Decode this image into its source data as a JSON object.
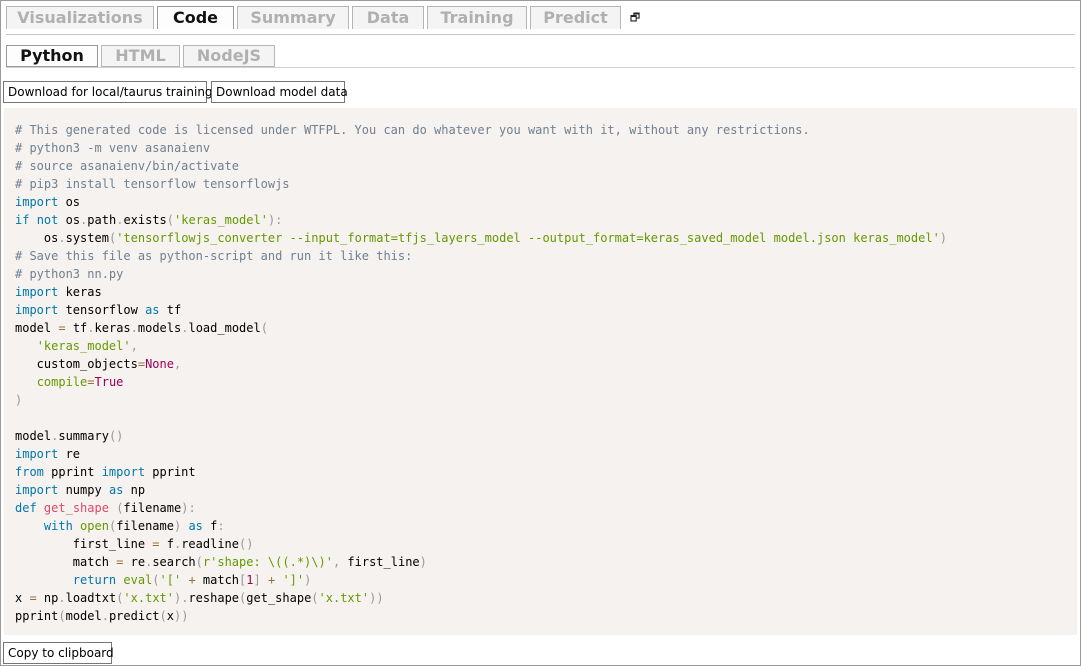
{
  "main_tabs": [
    {
      "label": "Visualizations",
      "active": false
    },
    {
      "label": "Code",
      "active": true
    },
    {
      "label": "Summary",
      "active": false
    },
    {
      "label": "Data",
      "active": false
    },
    {
      "label": "Training",
      "active": false
    },
    {
      "label": "Predict",
      "active": false
    }
  ],
  "restore_icon_glyph": "🗗",
  "sub_tabs": [
    {
      "label": "Python",
      "active": true
    },
    {
      "label": "HTML",
      "active": false
    },
    {
      "label": "NodeJS",
      "active": false
    }
  ],
  "buttons": {
    "download_local": "Download for local/taurus training",
    "download_model_data": "Download model data",
    "copy": "Copy to clipboard"
  },
  "code": {
    "language": "python",
    "lines": [
      [
        {
          "t": "c",
          "v": "# This generated code is licensed under WTFPL. You can do whatever you want with it, without any restrictions."
        }
      ],
      [
        {
          "t": "c",
          "v": "# python3 -m venv asanaienv"
        }
      ],
      [
        {
          "t": "c",
          "v": "# source asanaienv/bin/activate"
        }
      ],
      [
        {
          "t": "c",
          "v": "# pip3 install tensorflow tensorflowjs"
        }
      ],
      [
        {
          "t": "k",
          "v": "import"
        },
        {
          "t": "",
          "v": " os"
        }
      ],
      [
        {
          "t": "k",
          "v": "if"
        },
        {
          "t": "",
          "v": " "
        },
        {
          "t": "k",
          "v": "not"
        },
        {
          "t": "",
          "v": " os"
        },
        {
          "t": "p",
          "v": "."
        },
        {
          "t": "",
          "v": "path"
        },
        {
          "t": "p",
          "v": "."
        },
        {
          "t": "",
          "v": "exists"
        },
        {
          "t": "p",
          "v": "("
        },
        {
          "t": "s",
          "v": "'keras_model'"
        },
        {
          "t": "p",
          "v": "):"
        }
      ],
      [
        {
          "t": "",
          "v": "    os"
        },
        {
          "t": "p",
          "v": "."
        },
        {
          "t": "",
          "v": "system"
        },
        {
          "t": "p",
          "v": "("
        },
        {
          "t": "s",
          "v": "'tensorflowjs_converter --input_format=tfjs_layers_model --output_format=keras_saved_model model.json keras_model'"
        },
        {
          "t": "p",
          "v": ")"
        }
      ],
      [
        {
          "t": "c",
          "v": "# Save this file as python-script and run it like this:"
        }
      ],
      [
        {
          "t": "c",
          "v": "# python3 nn.py"
        }
      ],
      [
        {
          "t": "k",
          "v": "import"
        },
        {
          "t": "",
          "v": " keras"
        }
      ],
      [
        {
          "t": "k",
          "v": "import"
        },
        {
          "t": "",
          "v": " tensorflow "
        },
        {
          "t": "k",
          "v": "as"
        },
        {
          "t": "",
          "v": " tf"
        }
      ],
      [
        {
          "t": "",
          "v": "model "
        },
        {
          "t": "o",
          "v": "="
        },
        {
          "t": "",
          "v": " tf"
        },
        {
          "t": "p",
          "v": "."
        },
        {
          "t": "",
          "v": "keras"
        },
        {
          "t": "p",
          "v": "."
        },
        {
          "t": "",
          "v": "models"
        },
        {
          "t": "p",
          "v": "."
        },
        {
          "t": "",
          "v": "load_model"
        },
        {
          "t": "p",
          "v": "("
        }
      ],
      [
        {
          "t": "",
          "v": "   "
        },
        {
          "t": "s",
          "v": "'keras_model'"
        },
        {
          "t": "p",
          "v": ","
        }
      ],
      [
        {
          "t": "",
          "v": "   custom_objects"
        },
        {
          "t": "o",
          "v": "="
        },
        {
          "t": "n",
          "v": "None"
        },
        {
          "t": "p",
          "v": ","
        }
      ],
      [
        {
          "t": "",
          "v": "   "
        },
        {
          "t": "bi",
          "v": "compile"
        },
        {
          "t": "o",
          "v": "="
        },
        {
          "t": "n",
          "v": "True"
        }
      ],
      [
        {
          "t": "p",
          "v": ")"
        }
      ],
      [
        {
          "t": "",
          "v": ""
        }
      ],
      [
        {
          "t": "",
          "v": "model"
        },
        {
          "t": "p",
          "v": "."
        },
        {
          "t": "",
          "v": "summary"
        },
        {
          "t": "p",
          "v": "()"
        }
      ],
      [
        {
          "t": "k",
          "v": "import"
        },
        {
          "t": "",
          "v": " re"
        }
      ],
      [
        {
          "t": "k",
          "v": "from"
        },
        {
          "t": "",
          "v": " pprint "
        },
        {
          "t": "k",
          "v": "import"
        },
        {
          "t": "",
          "v": " pprint"
        }
      ],
      [
        {
          "t": "k",
          "v": "import"
        },
        {
          "t": "",
          "v": " numpy "
        },
        {
          "t": "k",
          "v": "as"
        },
        {
          "t": "",
          "v": " np"
        }
      ],
      [
        {
          "t": "k",
          "v": "def"
        },
        {
          "t": "",
          "v": " "
        },
        {
          "t": "f",
          "v": "get_shape"
        },
        {
          "t": "",
          "v": " "
        },
        {
          "t": "p",
          "v": "("
        },
        {
          "t": "",
          "v": "filename"
        },
        {
          "t": "p",
          "v": "):"
        }
      ],
      [
        {
          "t": "",
          "v": "    "
        },
        {
          "t": "k",
          "v": "with"
        },
        {
          "t": "",
          "v": " "
        },
        {
          "t": "bi",
          "v": "open"
        },
        {
          "t": "p",
          "v": "("
        },
        {
          "t": "",
          "v": "filename"
        },
        {
          "t": "p",
          "v": ")"
        },
        {
          "t": "",
          "v": " "
        },
        {
          "t": "k",
          "v": "as"
        },
        {
          "t": "",
          "v": " f"
        },
        {
          "t": "p",
          "v": ":"
        }
      ],
      [
        {
          "t": "",
          "v": "        first_line "
        },
        {
          "t": "o",
          "v": "="
        },
        {
          "t": "",
          "v": " f"
        },
        {
          "t": "p",
          "v": "."
        },
        {
          "t": "",
          "v": "readline"
        },
        {
          "t": "p",
          "v": "()"
        }
      ],
      [
        {
          "t": "",
          "v": "        match "
        },
        {
          "t": "o",
          "v": "="
        },
        {
          "t": "",
          "v": " re"
        },
        {
          "t": "p",
          "v": "."
        },
        {
          "t": "",
          "v": "search"
        },
        {
          "t": "p",
          "v": "("
        },
        {
          "t": "s",
          "v": "r'shape: \\((.*)\\)'"
        },
        {
          "t": "p",
          "v": ","
        },
        {
          "t": "",
          "v": " first_line"
        },
        {
          "t": "p",
          "v": ")"
        }
      ],
      [
        {
          "t": "",
          "v": "        "
        },
        {
          "t": "k",
          "v": "return"
        },
        {
          "t": "",
          "v": " "
        },
        {
          "t": "bi",
          "v": "eval"
        },
        {
          "t": "p",
          "v": "("
        },
        {
          "t": "s",
          "v": "'['"
        },
        {
          "t": "",
          "v": " "
        },
        {
          "t": "o",
          "v": "+"
        },
        {
          "t": "",
          "v": " match"
        },
        {
          "t": "p",
          "v": "["
        },
        {
          "t": "n",
          "v": "1"
        },
        {
          "t": "p",
          "v": "]"
        },
        {
          "t": "",
          "v": " "
        },
        {
          "t": "o",
          "v": "+"
        },
        {
          "t": "",
          "v": " "
        },
        {
          "t": "s",
          "v": "']'"
        },
        {
          "t": "p",
          "v": ")"
        }
      ],
      [
        {
          "t": "",
          "v": "x "
        },
        {
          "t": "o",
          "v": "="
        },
        {
          "t": "",
          "v": " np"
        },
        {
          "t": "p",
          "v": "."
        },
        {
          "t": "",
          "v": "loadtxt"
        },
        {
          "t": "p",
          "v": "("
        },
        {
          "t": "s",
          "v": "'x.txt'"
        },
        {
          "t": "p",
          "v": ")."
        },
        {
          "t": "",
          "v": "reshape"
        },
        {
          "t": "p",
          "v": "("
        },
        {
          "t": "",
          "v": "get_shape"
        },
        {
          "t": "p",
          "v": "("
        },
        {
          "t": "s",
          "v": "'x.txt'"
        },
        {
          "t": "p",
          "v": "))"
        }
      ],
      [
        {
          "t": "",
          "v": "pprint"
        },
        {
          "t": "p",
          "v": "("
        },
        {
          "t": "",
          "v": "model"
        },
        {
          "t": "p",
          "v": "."
        },
        {
          "t": "",
          "v": "predict"
        },
        {
          "t": "p",
          "v": "("
        },
        {
          "t": "",
          "v": "x"
        },
        {
          "t": "p",
          "v": "))"
        }
      ]
    ]
  }
}
